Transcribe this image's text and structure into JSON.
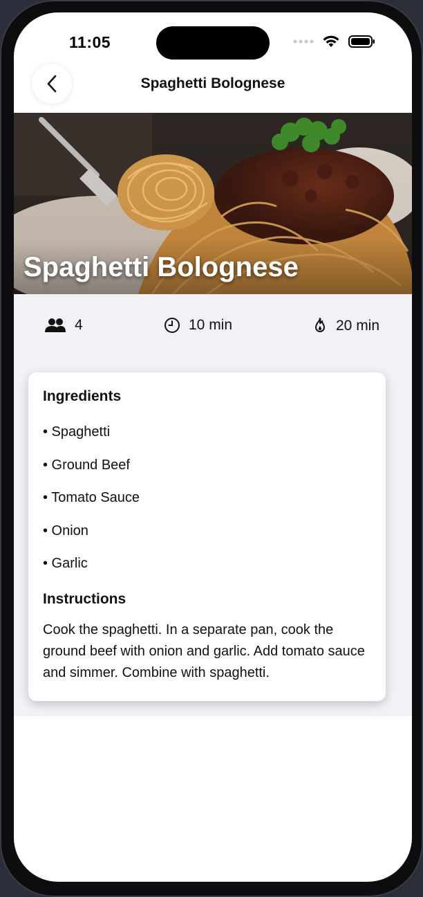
{
  "status_bar": {
    "time": "11:05"
  },
  "nav": {
    "title": "Spaghetti Bolognese"
  },
  "hero": {
    "title": "Spaghetti Bolognese"
  },
  "stats": {
    "servings": "4",
    "prep_time": "10 min",
    "cook_time": "20 min"
  },
  "ingredients": {
    "title": "Ingredients",
    "items": [
      "• Spaghetti",
      "• Ground Beef",
      "• Tomato Sauce",
      "• Onion",
      "• Garlic"
    ]
  },
  "instructions": {
    "title": "Instructions",
    "text": "Cook the spaghetti. In a separate pan, cook the ground beef with onion and garlic. Add tomato sauce and simmer. Combine with spaghetti."
  },
  "icons": {
    "back": "chevron-left-icon",
    "servings": "people-icon",
    "prep_time": "clock-icon",
    "cook_time": "flame-icon"
  },
  "colors": {
    "screen_background": "#ffffff",
    "content_background": "#f1f1f6",
    "text": "#111111"
  }
}
